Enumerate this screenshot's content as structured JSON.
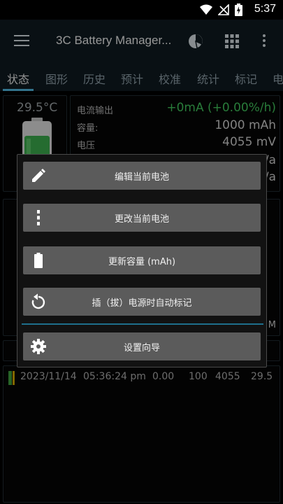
{
  "status_bar": {
    "time": "5:37"
  },
  "app_bar": {
    "title": "3C Battery Manager..."
  },
  "tabs": [
    {
      "label": "状态"
    },
    {
      "label": "图形"
    },
    {
      "label": "历史"
    },
    {
      "label": "预计"
    },
    {
      "label": "校准"
    },
    {
      "label": "统计"
    },
    {
      "label": "标记"
    },
    {
      "label": "电"
    }
  ],
  "status": {
    "temperature": "29.5°C",
    "current_label": "电流输出",
    "current_value": "+0mA (+0.00%/h)",
    "capacity_label": "容量:",
    "capacity_value": "1000 mAh",
    "voltage_label": "电压",
    "voltage_value": "4055 mV",
    "partial_value_1": "/a",
    "partial_value_2": "/a",
    "partial_m": "M"
  },
  "log": {
    "date": "2023/11/14",
    "time": "05:36:24 pm",
    "current": "0.00",
    "level": "100",
    "voltage": "4055",
    "temp": "29.5"
  },
  "dialog": {
    "items": [
      {
        "label": "编辑当前电池",
        "icon": "pencil-icon"
      },
      {
        "label": "更改当前电池",
        "icon": "vertical-dots-icon"
      },
      {
        "label": "更新容量 (mAh)",
        "icon": "battery-icon"
      },
      {
        "label": "插（拔）电源时自动标记",
        "icon": "refresh-icon"
      },
      {
        "label": "设置向导",
        "icon": "gear-icon"
      }
    ]
  },
  "colors": {
    "accent": "#4fb3d9",
    "green": "#3fbf5a",
    "dialog_button": "#5b5b5b"
  }
}
